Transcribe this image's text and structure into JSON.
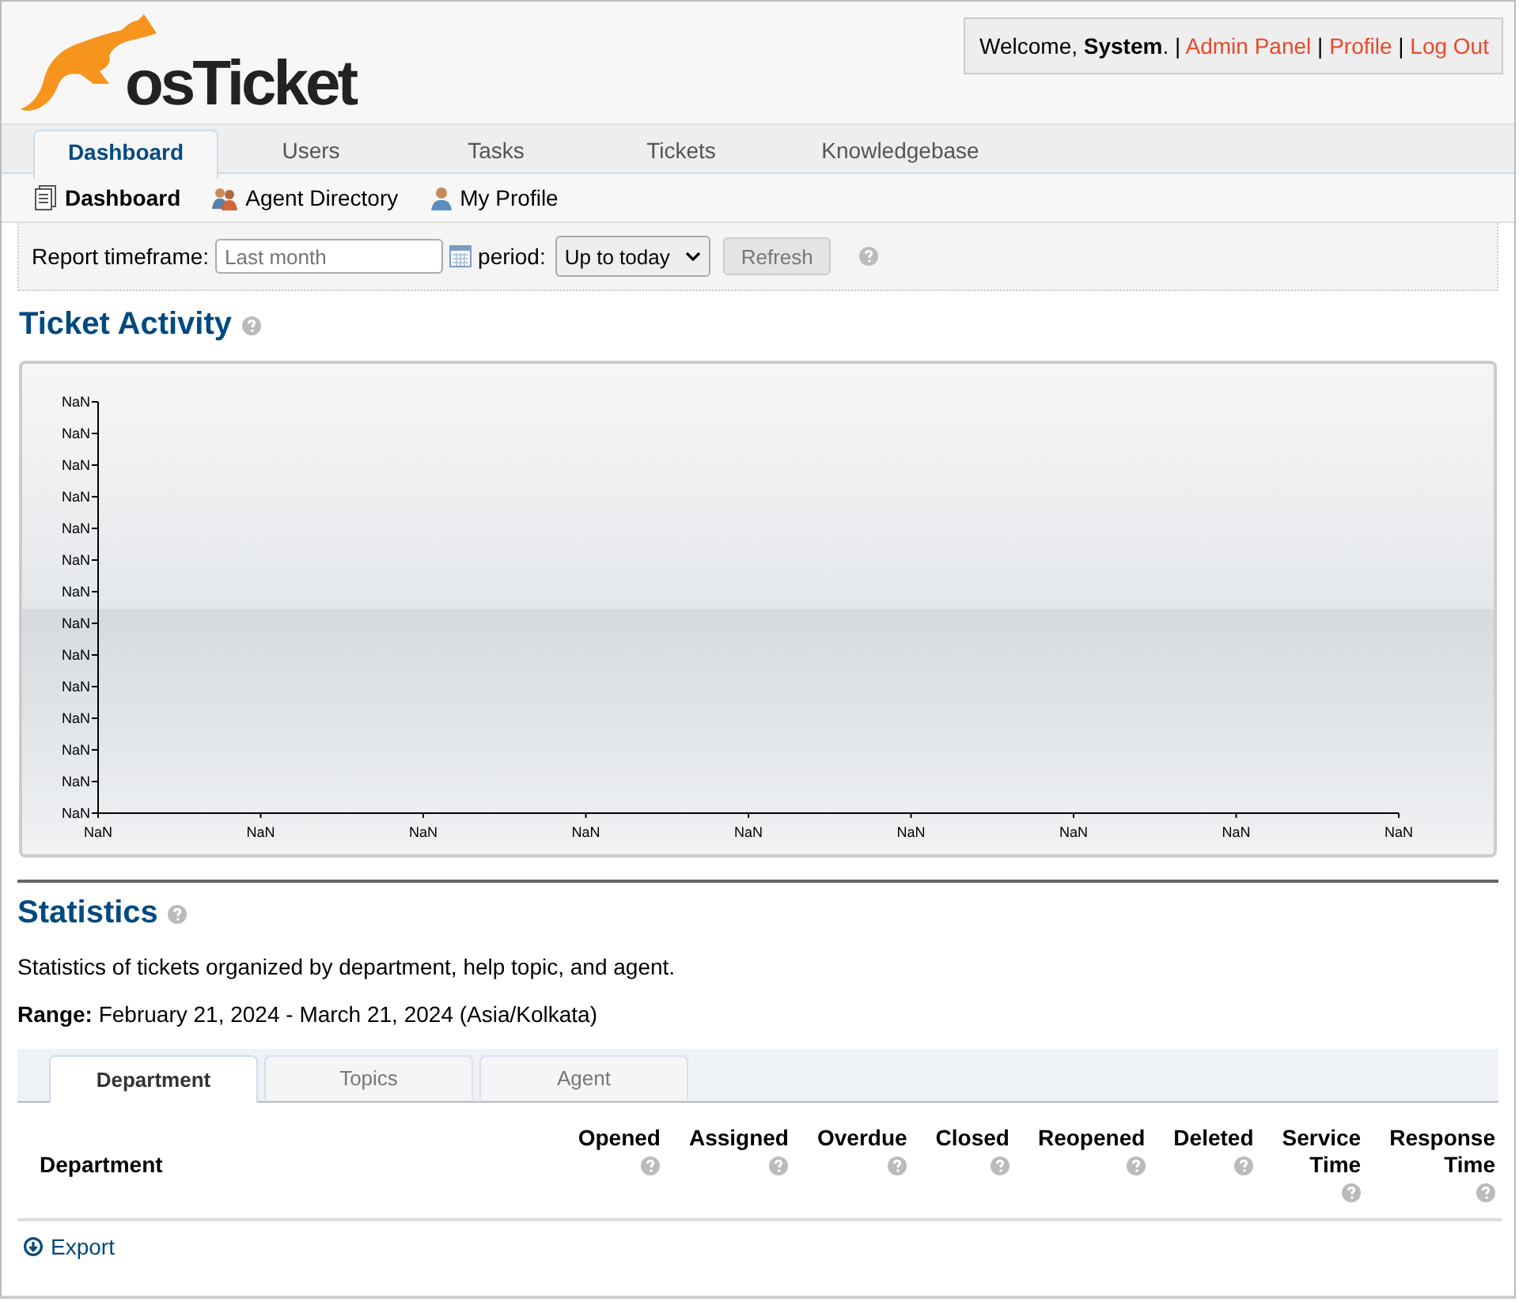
{
  "logo": {
    "text": "osTicket"
  },
  "welcome": {
    "greeting": "Welcome, ",
    "user": "System",
    "user_suffix": ".",
    "separator": "|",
    "links": [
      "Admin Panel",
      "Profile",
      "Log Out"
    ]
  },
  "nav_tabs": [
    {
      "label": "Dashboard",
      "selected": true
    },
    {
      "label": "Users",
      "selected": false
    },
    {
      "label": "Tasks",
      "selected": false
    },
    {
      "label": "Tickets",
      "selected": false
    },
    {
      "label": "Knowledgebase",
      "selected": false
    }
  ],
  "sub_nav": [
    {
      "label": "Dashboard",
      "kind": "document",
      "selected": true
    },
    {
      "label": "Agent Directory",
      "kind": "people",
      "selected": false
    },
    {
      "label": "My Profile",
      "kind": "person",
      "selected": false
    }
  ],
  "filter": {
    "timeframe_label": "Report timeframe:",
    "timeframe_placeholder": "Last month",
    "period_label": "period:",
    "period_value": "Up to today",
    "refresh": "Refresh"
  },
  "ticket_activity": {
    "title": "Ticket Activity",
    "y_ticks": [
      "NaN",
      "NaN",
      "NaN",
      "NaN",
      "NaN",
      "NaN",
      "NaN",
      "NaN",
      "NaN",
      "NaN",
      "NaN",
      "NaN",
      "NaN",
      "NaN"
    ],
    "x_ticks": [
      "NaN",
      "NaN",
      "NaN",
      "NaN",
      "NaN",
      "NaN",
      "NaN",
      "NaN",
      "NaN"
    ]
  },
  "statistics": {
    "title": "Statistics",
    "description": "Statistics of tickets organized by department, help topic, and agent.",
    "range_label": "Range:",
    "range_value": "February 21, 2024 - March 21, 2024 (Asia/Kolkata)",
    "tabs": [
      {
        "label": "Department",
        "selected": true
      },
      {
        "label": "Topics",
        "selected": false
      },
      {
        "label": "Agent",
        "selected": false
      }
    ],
    "columns": [
      {
        "label": "Department",
        "help": false
      },
      {
        "label": "Opened",
        "help": true
      },
      {
        "label": "Assigned",
        "help": true
      },
      {
        "label": "Overdue",
        "help": true
      },
      {
        "label": "Closed",
        "help": true
      },
      {
        "label": "Reopened",
        "help": true
      },
      {
        "label": "Deleted",
        "help": true
      },
      {
        "label": "Service Time",
        "help": true
      },
      {
        "label": "Response Time",
        "help": true
      }
    ],
    "export": "Export"
  }
}
